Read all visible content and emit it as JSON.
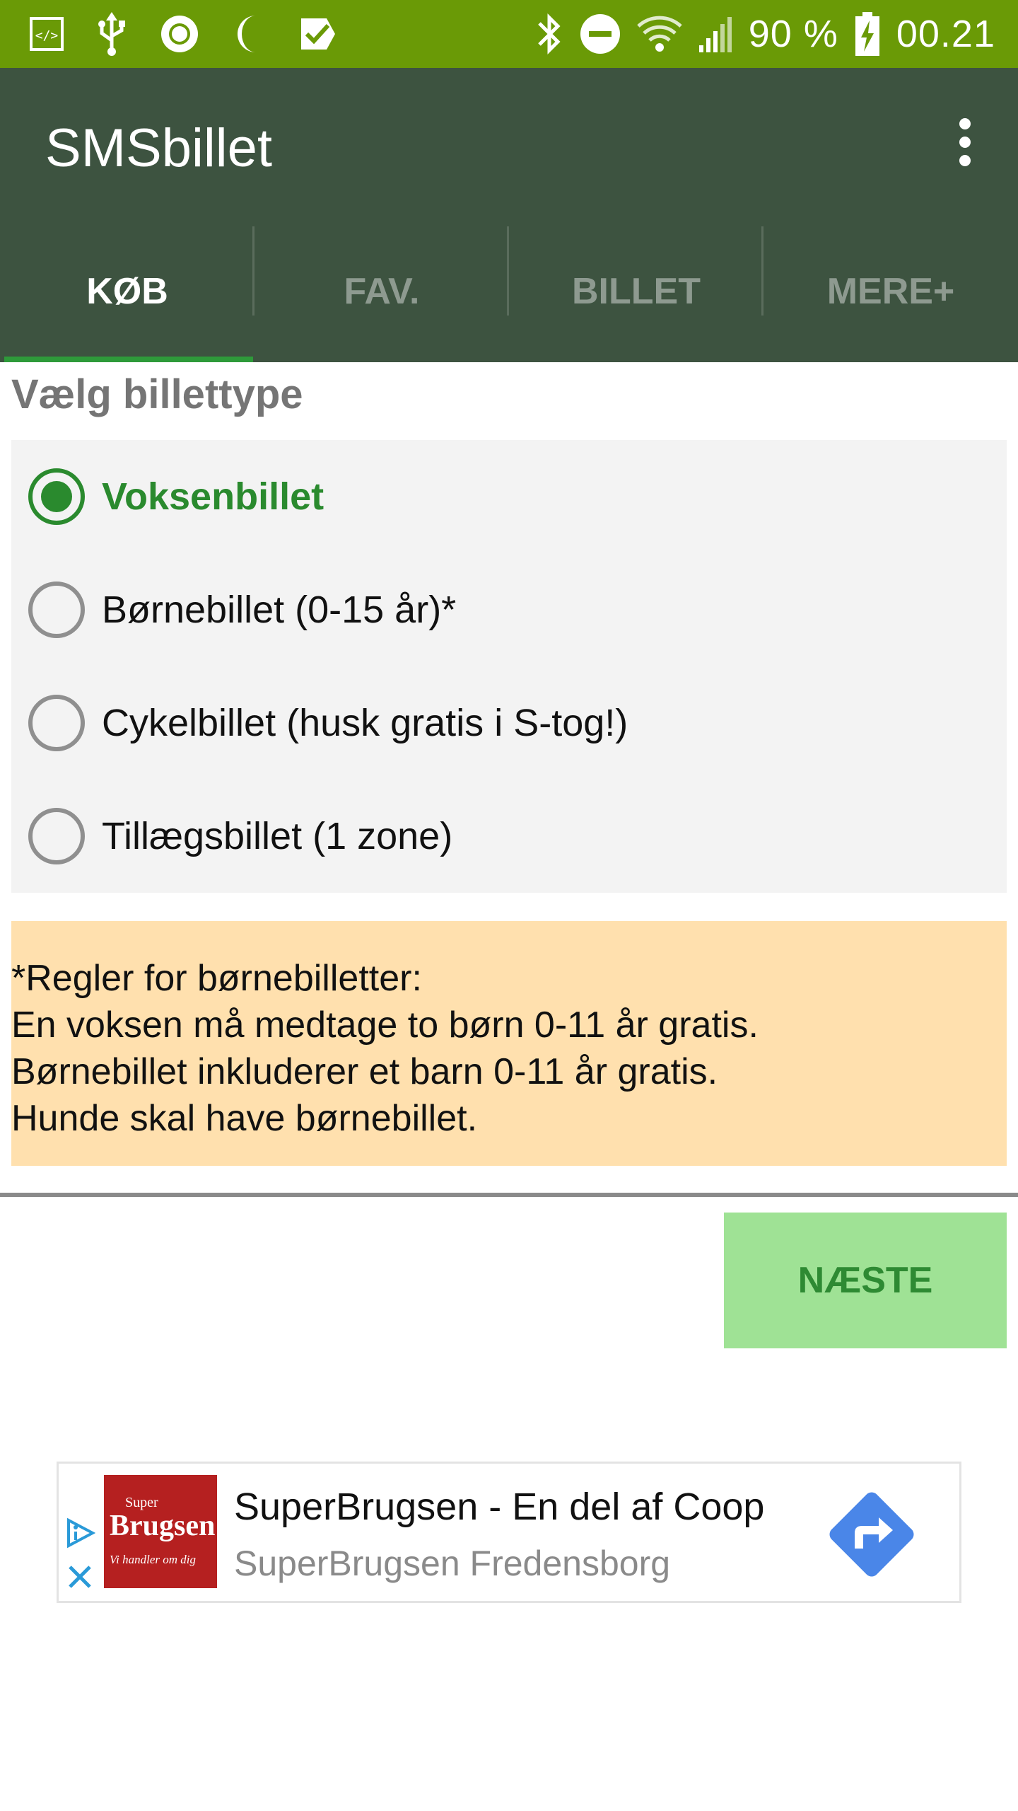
{
  "status_bar": {
    "battery_text": "90 %",
    "time": "00.21",
    "icons_left": [
      "developer-mode-icon",
      "usb-icon",
      "circle-icon",
      "night-mode-icon",
      "check-inbox-icon"
    ],
    "icons_right": [
      "bluetooth-icon",
      "do-not-disturb-icon",
      "wifi-icon",
      "signal-icon",
      "battery-charging-icon"
    ]
  },
  "app_bar": {
    "title": "SMSbillet",
    "menu_icon": "more-vertical-icon"
  },
  "tabs": [
    {
      "label": "KØB",
      "active": true
    },
    {
      "label": "FAV.",
      "active": false
    },
    {
      "label": "BILLET",
      "active": false
    },
    {
      "label": "MERE+",
      "active": false
    }
  ],
  "ticket_type": {
    "heading": "Vælg billettype",
    "options": [
      {
        "label": "Voksenbillet",
        "selected": true
      },
      {
        "label": "Børnebillet (0-15 år)*",
        "selected": false
      },
      {
        "label": "Cykelbillet (husk gratis i S-tog!)",
        "selected": false
      },
      {
        "label": "Tillægsbillet (1 zone)",
        "selected": false
      }
    ]
  },
  "info": {
    "lines": [
      "*Regler for børnebilletter:",
      "En voksen må medtage to børn 0-11 år gratis.",
      "Børnebillet inkluderer et barn 0-11 år gratis.",
      "Hunde skal have børnebillet."
    ]
  },
  "next_button": {
    "label": "NÆSTE"
  },
  "ad": {
    "logo_text_small": "Super",
    "logo_text_main": "Brugsen",
    "logo_tagline": "Vi handler om dig",
    "title": "SuperBrugsen - En del af Coop",
    "subtitle": "SuperBrugsen Fredensborg",
    "action_icon": "directions-icon"
  },
  "colors": {
    "status_bar": "#6a9a06",
    "app_bar": "#3d5340",
    "accent_green": "#2a8a2e",
    "info_background": "#ffe0ae",
    "next_button_background": "#9fe295",
    "ad_directions": "#4a86e8",
    "ad_logo": "#b52020"
  }
}
